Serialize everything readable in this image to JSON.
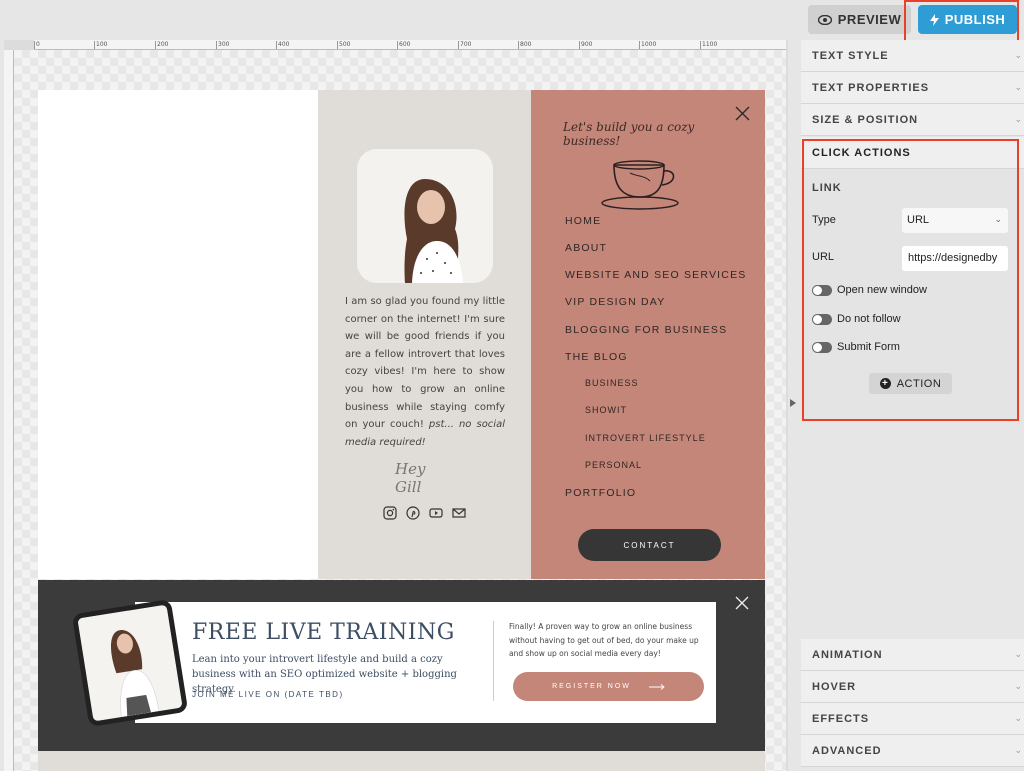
{
  "toolbar": {
    "preview_label": "PREVIEW",
    "publish_label": "PUBLISH"
  },
  "ruler": {
    "ticks": [
      "0",
      "100",
      "200",
      "300",
      "400",
      "500",
      "600",
      "700",
      "800",
      "900",
      "1000",
      "1100"
    ]
  },
  "bio": {
    "text": "I am so glad you found my little corner on the internet! I'm sure we will be good friends if you are a fellow introvert that loves cozy vibes! I'm here to show you how to grow an online business while staying comfy on your couch!",
    "italic": "pst... no social media required!",
    "signature": "Hey Gill"
  },
  "menu": {
    "tagline": "Let's build you a cozy business!",
    "items": [
      {
        "label": "HOME"
      },
      {
        "label": "ABOUT"
      },
      {
        "label": "WEBSITE AND SEO SERVICES"
      },
      {
        "label": "VIP DESIGN DAY"
      },
      {
        "label": "BLOGGING FOR BUSINESS"
      },
      {
        "label": "THE BLOG"
      }
    ],
    "sub_items": [
      {
        "label": "BUSINESS"
      },
      {
        "label": "SHOWIT"
      },
      {
        "label": "INTROVERT LIFESTYLE"
      },
      {
        "label": "PERSONAL"
      }
    ],
    "portfolio": "PORTFOLIO",
    "contact": "CONTACT"
  },
  "banner": {
    "title": "FREE LIVE TRAINING",
    "subtitle": "Lean into your introvert lifestyle and build a cozy business with an SEO optimized website + blogging strategy.",
    "join": "JOIN ME LIVE ON (DATE TBD)",
    "description": "Finally! A proven way to grow an online business without having to get out of bed, do your make up and show up on social media every day!",
    "register": "REGISTER NOW"
  },
  "panel": {
    "sections_top": [
      "TEXT STYLE",
      "TEXT PROPERTIES",
      "SIZE & POSITION"
    ],
    "click_actions": "CLICK ACTIONS",
    "link_heading": "LINK",
    "type_label": "Type",
    "type_value": "URL",
    "url_label": "URL",
    "url_value": "https://designedby",
    "toggles": [
      "Open new window",
      "Do not follow",
      "Submit Form"
    ],
    "action_label": "ACTION",
    "sections_bottom": [
      "ANIMATION",
      "HOVER",
      "EFFECTS",
      "ADVANCED"
    ]
  },
  "colors": {
    "accent": "#2e9dd6",
    "terracotta": "#c48679",
    "highlight": "#e8412a"
  }
}
